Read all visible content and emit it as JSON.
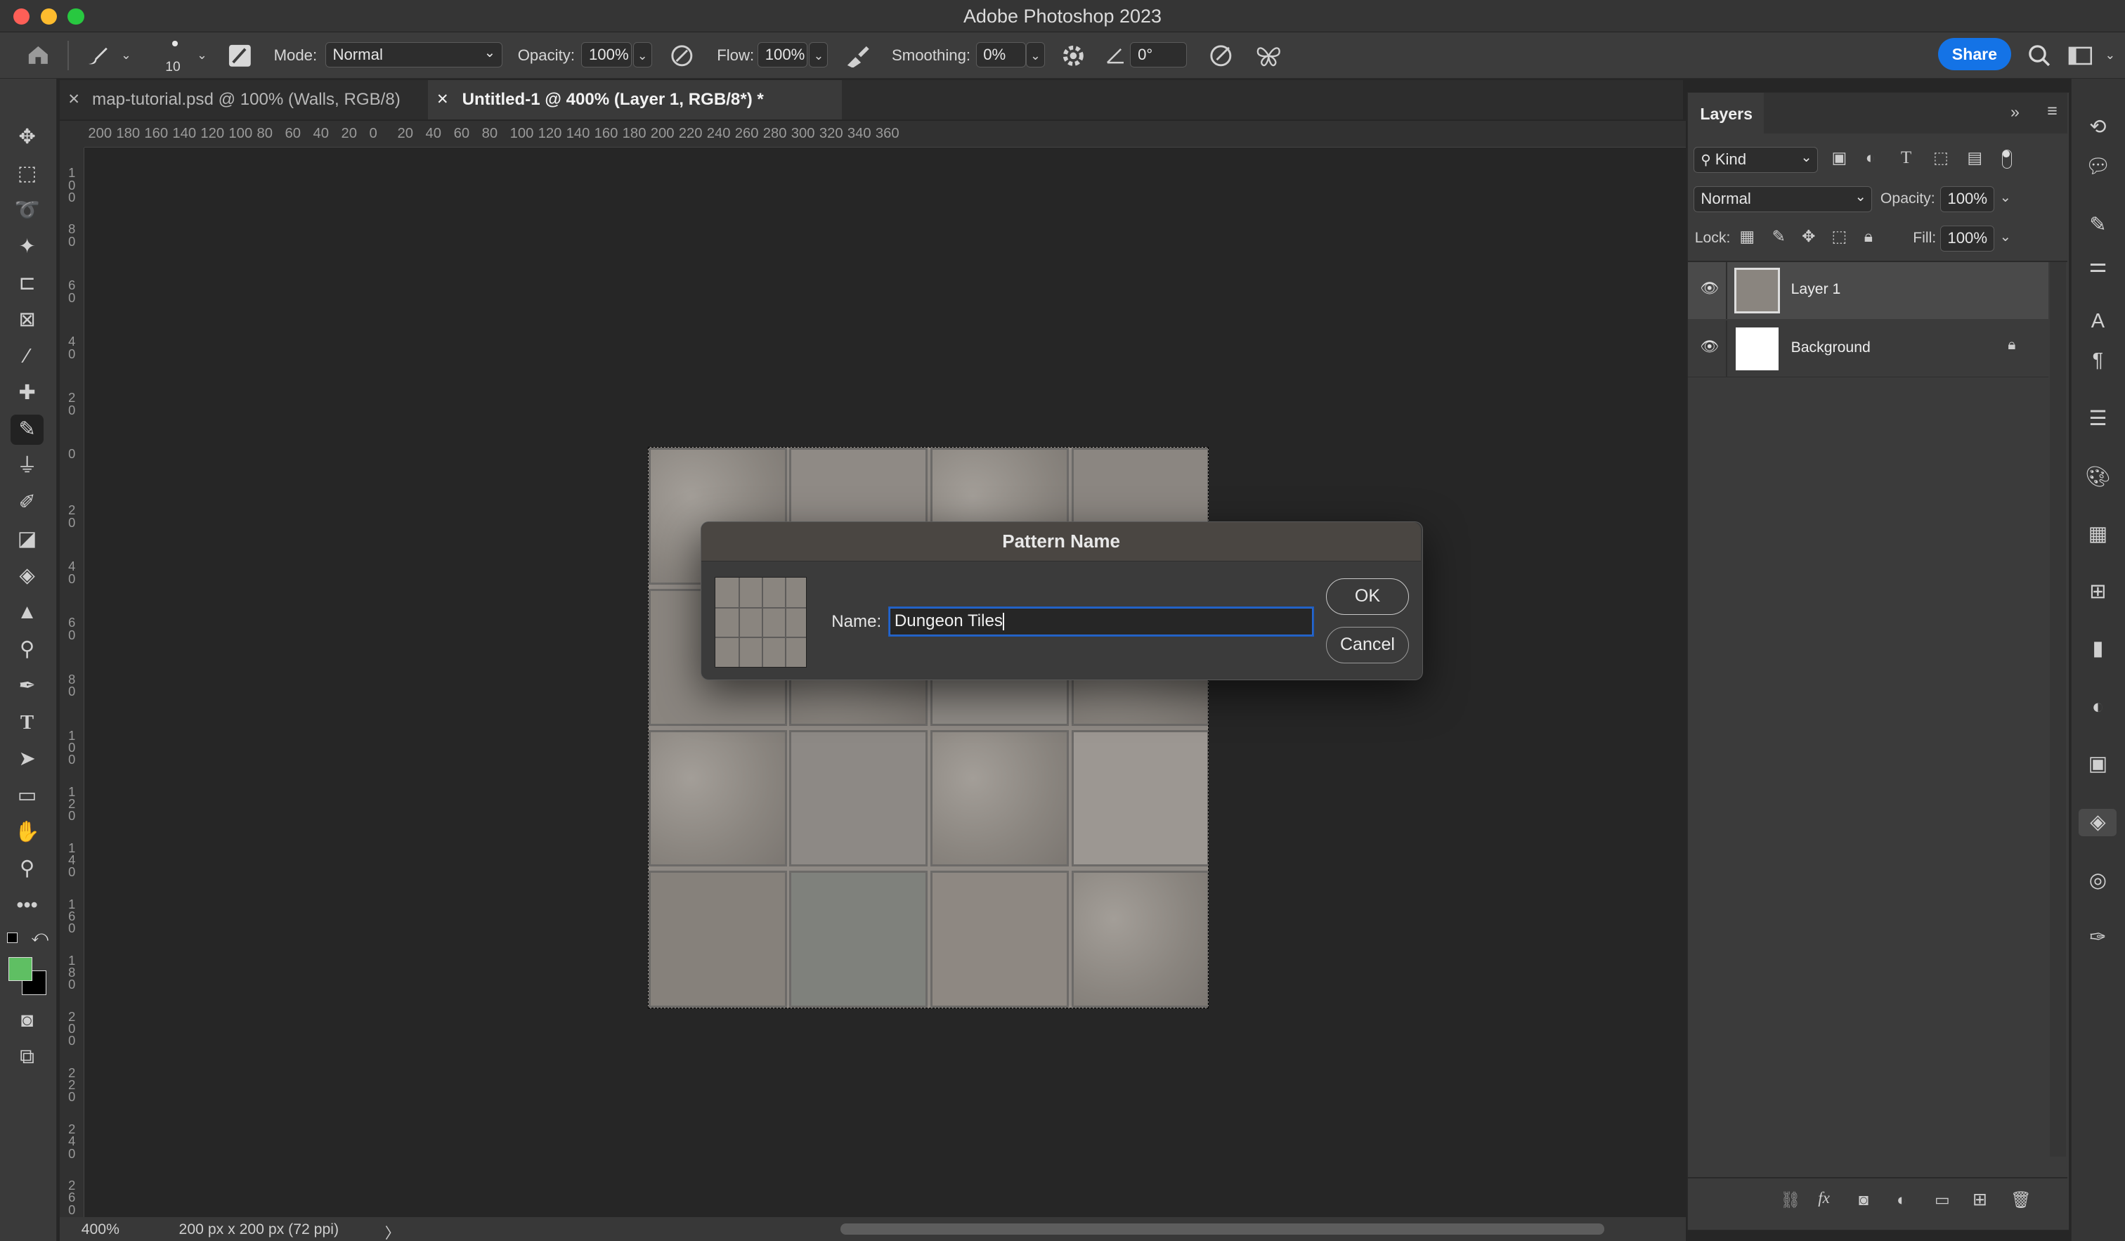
{
  "window": {
    "title": "Adobe Photoshop 2023"
  },
  "options_bar": {
    "brush_size": "10",
    "mode_label": "Mode:",
    "mode_value": "Normal",
    "opacity_label": "Opacity:",
    "opacity_value": "100%",
    "flow_label": "Flow:",
    "flow_value": "100%",
    "smoothing_label": "Smoothing:",
    "smoothing_value": "0%",
    "angle_value": "0°",
    "share_label": "Share"
  },
  "tabs": [
    {
      "label": "map-tutorial.psd @ 100% (Walls, RGB/8)",
      "active": false
    },
    {
      "label": "Untitled-1 @ 400% (Layer 1, RGB/8*) *",
      "active": true
    }
  ],
  "ruler": {
    "h_labels": [
      "200",
      "180",
      "160",
      "140",
      "120",
      "100",
      "80",
      "60",
      "40",
      "20",
      "0",
      "20",
      "40",
      "60",
      "80",
      "100",
      "120",
      "140",
      "160",
      "180",
      "200",
      "220",
      "240",
      "260",
      "280",
      "300",
      "320",
      "340",
      "360"
    ],
    "v_labels": [
      "100",
      "80",
      "60",
      "40",
      "20",
      "0",
      "20",
      "40",
      "60",
      "80",
      "100",
      "120",
      "140",
      "160",
      "180",
      "200",
      "220",
      "240",
      "260"
    ]
  },
  "status_bar": {
    "zoom": "400%",
    "doc_info": "200 px x 200 px (72 ppi)",
    "arrow": "〉"
  },
  "layers_panel": {
    "title": "Layers",
    "filter_kind": "Kind",
    "blend_mode": "Normal",
    "opacity_label": "Opacity:",
    "opacity_value": "100%",
    "lock_label": "Lock:",
    "fill_label": "Fill:",
    "fill_value": "100%",
    "layers": [
      {
        "name": "Layer 1",
        "selected": true
      },
      {
        "name": "Background",
        "selected": false,
        "locked": true
      }
    ]
  },
  "dialog": {
    "title": "Pattern Name",
    "name_label": "Name:",
    "name_value": "Dungeon Tiles",
    "ok_label": "OK",
    "cancel_label": "Cancel"
  },
  "colors": {
    "foreground": "#5fbf63",
    "background": "#000000",
    "accent": "#1473e6",
    "selected_layer": "#4a4a4a"
  }
}
